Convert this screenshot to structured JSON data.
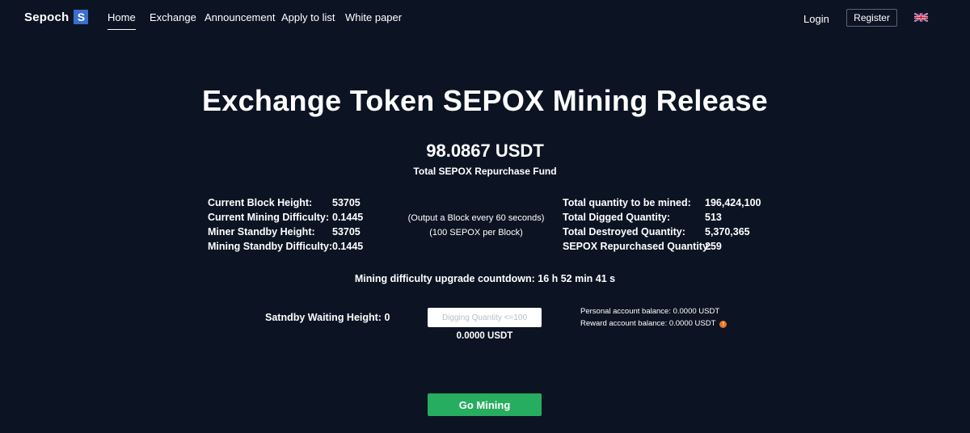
{
  "nav": {
    "logo_text": "Sepoch",
    "logo_badge": "S",
    "items": [
      {
        "label": "Home",
        "active": true
      },
      {
        "label": "Exchange",
        "active": false
      },
      {
        "label": "Announcement",
        "active": false
      },
      {
        "label": "Apply to list",
        "active": false
      },
      {
        "label": "White paper",
        "active": false
      }
    ],
    "login_label": "Login",
    "register_label": "Register",
    "language_icon": "uk-flag-icon"
  },
  "hero": {
    "title": "Exchange Token SEPOX Mining Release",
    "fund_value": "98.0867 USDT",
    "fund_label": "Total SEPOX Repurchase Fund"
  },
  "left_stats": [
    {
      "label": "Current Block Height:",
      "value": "53705"
    },
    {
      "label": "Current Mining Difficulty:",
      "value": "0.1445"
    },
    {
      "label": "Miner Standby Height:",
      "value": "53705"
    },
    {
      "label": "Mining Standby Difficulty:",
      "value": "0.1445"
    }
  ],
  "center_notes": [
    "(Output a Block every 60 seconds)",
    "(100 SEPOX per Block)"
  ],
  "right_stats": [
    {
      "label": "Total quantity to be mined:",
      "value": "196,424,100"
    },
    {
      "label": "Total Digged Quantity:",
      "value": "513"
    },
    {
      "label": "Total Destroyed Quantity:",
      "value": "5,370,365"
    },
    {
      "label": "SEPOX Repurchased Quantity:",
      "value": "259"
    }
  ],
  "countdown": {
    "text": "Mining difficulty upgrade countdown:  16 h 52 min 41 s"
  },
  "mining": {
    "standby_text": "Satndby Waiting Height:  0",
    "input_value": "",
    "input_placeholder": "Digging Quantity <=100",
    "total": "0.0000  USDT",
    "personal_balance": "Personal account balance:  0.0000  USDT",
    "reward_balance": "Reward account balance:  0.0000  USDT",
    "info_icon": "info-icon",
    "button_label": "Go Mining"
  },
  "colors": {
    "background": "#0c1424",
    "logo_badge": "#3a6fd0",
    "go_button": "#27ad5f",
    "info_icon": "#e8741e"
  }
}
